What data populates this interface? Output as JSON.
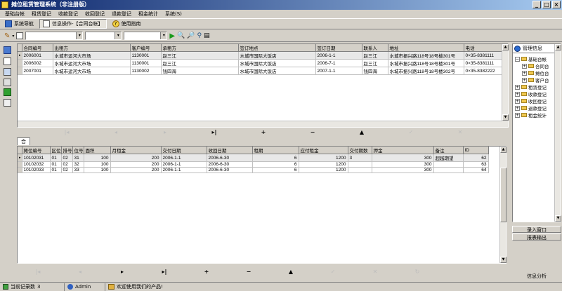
{
  "window": {
    "title": "摊位租赁管理系统（非注册版）"
  },
  "menu": [
    "基础台帐",
    "租赁登记",
    "收款登记",
    "收回登记",
    "退款登记",
    "租金统计",
    "系统(S)"
  ],
  "toolbar1": {
    "nav": "系统导航",
    "info": "信息操作-【合同台帐】",
    "help": "使用指南"
  },
  "contracts": {
    "headers": [
      "合同编号",
      "出租方",
      "客户编号",
      "承租方",
      "签订地点",
      "签订日期",
      "联系人",
      "地址",
      "电话"
    ],
    "rows": [
      [
        "2006001",
        "水城市运河大市场",
        "1130001",
        "赵三江",
        "水城市国际大饭店",
        "2006-1-1",
        "赵三江",
        "水城市振兴路118号18号楼301号",
        "0×35-8381111"
      ],
      [
        "2006002",
        "水城市运河大市场",
        "1130001",
        "赵三江",
        "水城市国际大饭店",
        "2006-7-1",
        "赵三江",
        "水城市振兴路118号18号楼301号",
        "0×35-8381111"
      ],
      [
        "2007001",
        "水城市运河大市场",
        "1130002",
        "钱四海",
        "水城市国际大饭店",
        "2007-1-1",
        "钱四海",
        "水城市振兴路118号18号楼302号",
        "0×35-8382222"
      ]
    ]
  },
  "nav_top": [
    "▸|",
    "+",
    "−",
    "▲"
  ],
  "tab_label": "合同从表",
  "details": {
    "headers": [
      "摊位编号",
      "区位",
      "排号",
      "位号",
      "面积",
      "月租金",
      "交付日期",
      "收回日期",
      "租期",
      "应付租金",
      "交付期数",
      "押金",
      "备注",
      "ID"
    ],
    "rows": [
      [
        "10102031",
        "01",
        "02",
        "31",
        "100",
        "200",
        "2006-1-1",
        "2006-6-30",
        "6",
        "1200",
        "3",
        "300",
        "超越期望",
        "62"
      ],
      [
        "10102032",
        "01",
        "02",
        "32",
        "100",
        "200",
        "2006-1-1",
        "2006-6-30",
        "6",
        "1200",
        "",
        "300",
        "",
        "63"
      ],
      [
        "10102033",
        "01",
        "02",
        "33",
        "100",
        "200",
        "2006-1-1",
        "2006-6-30",
        "6",
        "1200",
        "",
        "300",
        "",
        "64"
      ]
    ]
  },
  "nav_bottom": [
    "|◂",
    "◂",
    "▸",
    "▸|",
    "+",
    "−",
    "▲",
    "✓",
    "✕",
    "↻"
  ],
  "tree": {
    "title": "管理信息",
    "nodes": [
      "基础台帐",
      "合同台",
      "摊位台",
      "客户台",
      "租赁登记",
      "收款登记",
      "收回登记",
      "退款登记",
      "租金统计"
    ]
  },
  "right_buttons": [
    "录入窗口",
    "报表输出",
    "信息分析"
  ],
  "status": {
    "count_label": "当前记录数",
    "count": "3",
    "user": "Admin",
    "welcome": "欢迎使用我们的产品!"
  },
  "colors": {
    "titlebar": "#0a246a",
    "face": "#d4d0c8",
    "selected_row": "#e8e8e8"
  }
}
